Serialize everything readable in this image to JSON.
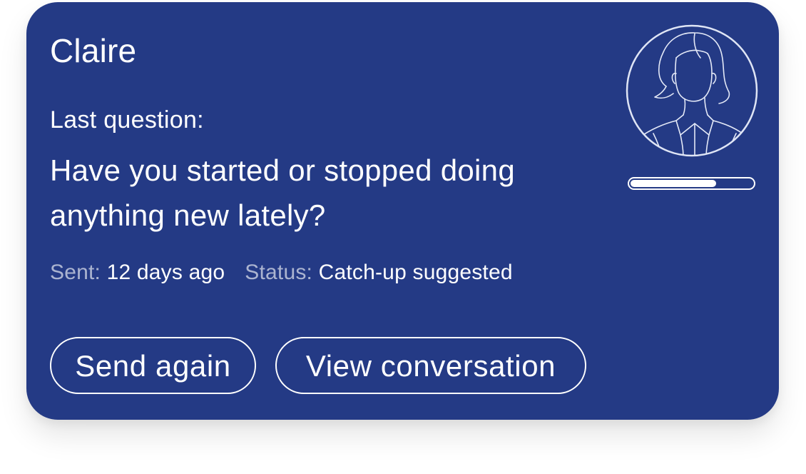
{
  "card": {
    "name": "Claire",
    "question_label": "Last question:",
    "question_text": "Have you started or stopped doing anything new lately?",
    "sent_label": "Sent:",
    "sent_value": "12 days ago",
    "status_label": "Status:",
    "status_value": "Catch-up suggested",
    "progress_fraction": 0.7,
    "avatar_icon": "person-outline-icon",
    "colors": {
      "background": "#243a85",
      "text": "#ffffff"
    }
  },
  "actions": {
    "send_again_label": "Send again",
    "view_conversation_label": "View conversation"
  }
}
